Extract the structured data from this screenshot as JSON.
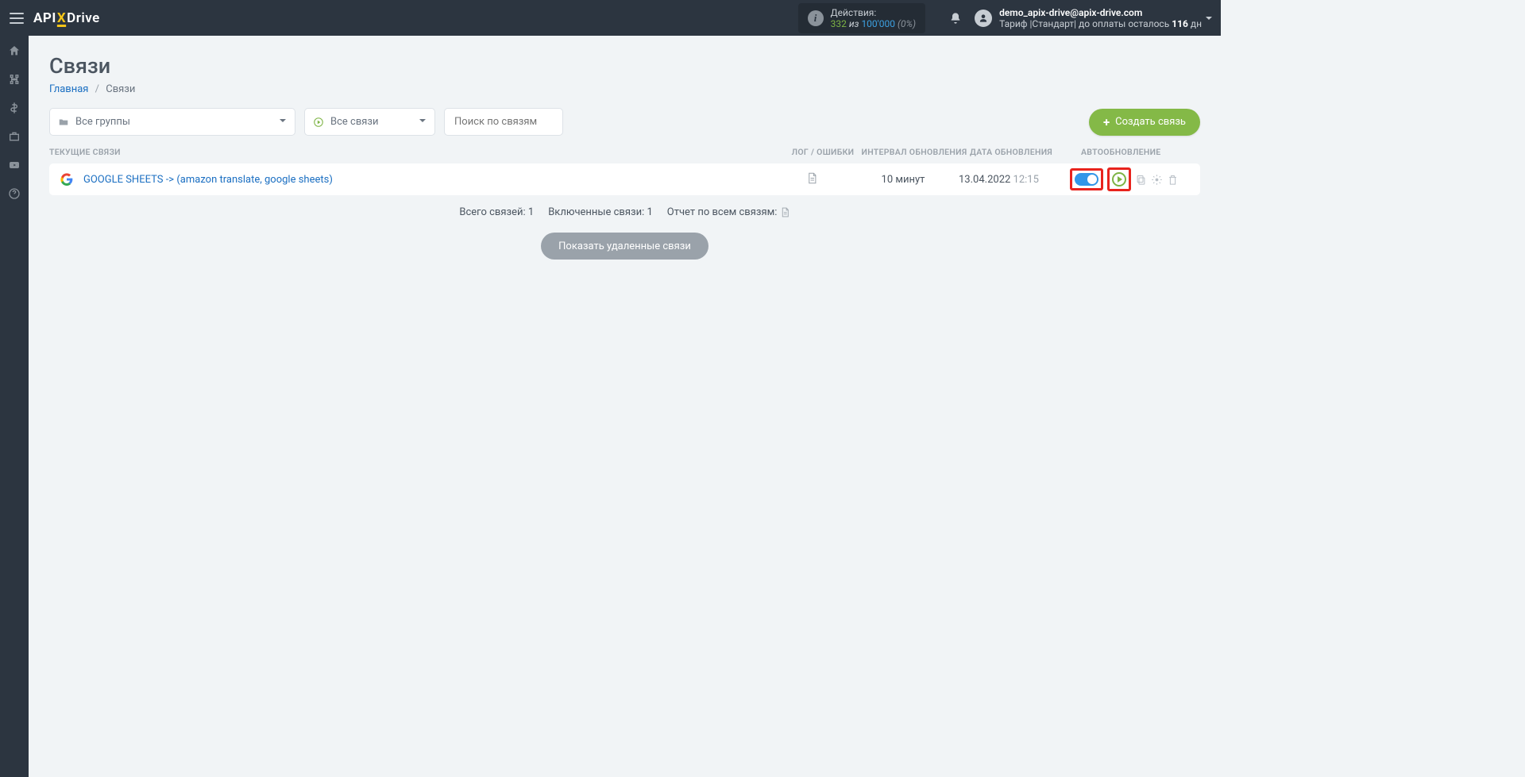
{
  "header": {
    "actions_label": "Действия:",
    "actions_used": "332",
    "actions_of_word": "из",
    "actions_total": "100'000",
    "actions_percent": "(0%)",
    "user_email": "demo_apix-drive@apix-drive.com",
    "tariff_prefix": "Тариф |Стандарт| до оплаты осталось ",
    "tariff_days": "116",
    "tariff_suffix": " дн"
  },
  "page": {
    "title": "Связи",
    "crumb_home": "Главная",
    "crumb_current": "Связи"
  },
  "filters": {
    "groups_label": "Все группы",
    "conns_label": "Все связи",
    "search_placeholder": "Поиск по связям",
    "create_btn": "Создать связь"
  },
  "table": {
    "h1": "ТЕКУЩИЕ СВЯЗИ",
    "h2": "ЛОГ / ОШИБКИ",
    "h3": "ИНТЕРВАЛ ОБНОВЛЕНИЯ",
    "h4": "ДАТА ОБНОВЛЕНИЯ",
    "h5": "АВТООБНОВЛЕНИЕ",
    "row": {
      "name": "GOOGLE SHEETS -> (amazon translate, google sheets)",
      "interval": "10 минут",
      "date": "13.04.2022",
      "time": "12:15"
    }
  },
  "stats": {
    "total_label": "Всего связей: ",
    "total": "1",
    "enabled_label": "Включенные связи: ",
    "enabled": "1",
    "report_label": "Отчет по всем связям:"
  },
  "show_deleted": "Показать удаленные связи"
}
